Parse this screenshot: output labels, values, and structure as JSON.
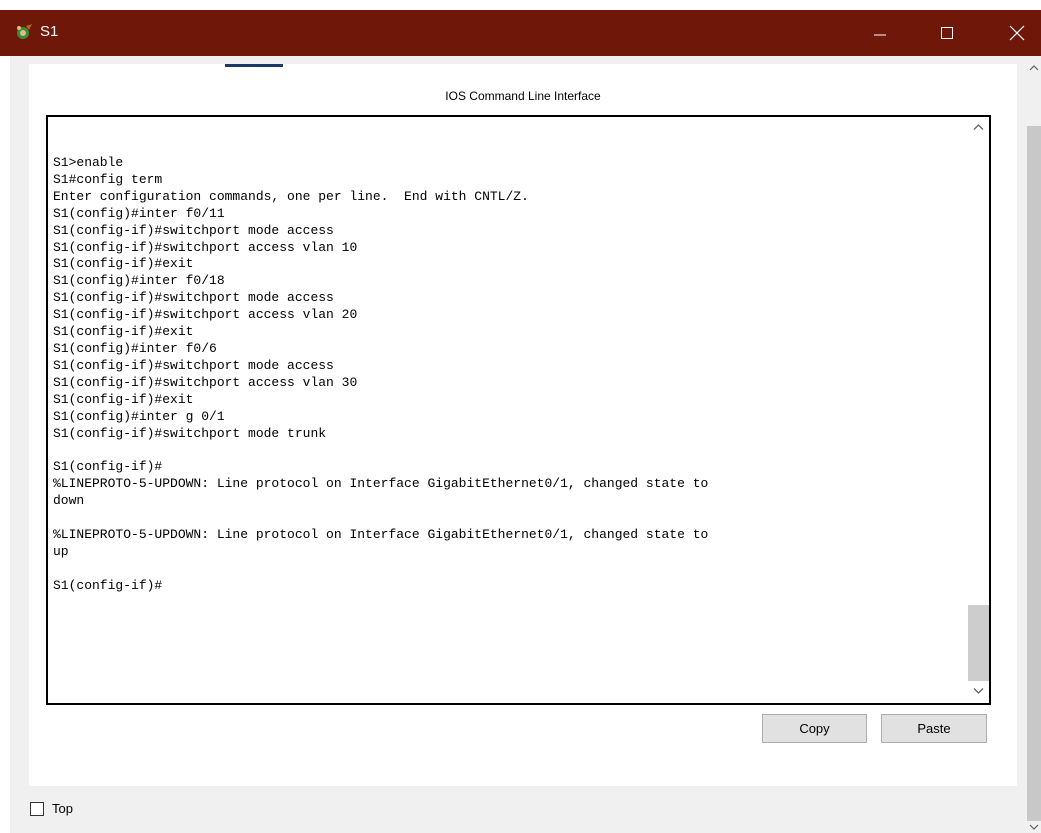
{
  "window": {
    "title": "S1"
  },
  "panel": {
    "title": "IOS Command Line Interface"
  },
  "terminal": {
    "lines": [
      "S1>enable",
      "S1#config term",
      "Enter configuration commands, one per line.  End with CNTL/Z.",
      "S1(config)#inter f0/11",
      "S1(config-if)#switchport mode access",
      "S1(config-if)#switchport access vlan 10",
      "S1(config-if)#exit",
      "S1(config)#inter f0/18",
      "S1(config-if)#switchport mode access",
      "S1(config-if)#switchport access vlan 20",
      "S1(config-if)#exit",
      "S1(config)#inter f0/6",
      "S1(config-if)#switchport mode access",
      "S1(config-if)#switchport access vlan 30",
      "S1(config-if)#exit",
      "S1(config)#inter g 0/1",
      "S1(config-if)#switchport mode trunk",
      "",
      "S1(config-if)#",
      "%LINEPROTO-5-UPDOWN: Line protocol on Interface GigabitEthernet0/1, changed state to",
      "down",
      "",
      "%LINEPROTO-5-UPDOWN: Line protocol on Interface GigabitEthernet0/1, changed state to",
      "up",
      "",
      "S1(config-if)#"
    ],
    "text": ""
  },
  "buttons": {
    "copy": "Copy",
    "paste": "Paste"
  },
  "top_checkbox": {
    "label": "Top",
    "checked": false
  },
  "colors": {
    "titlebar": "#6f1709",
    "frame": "#f0f0f0",
    "button": "#e1e1e1"
  },
  "icons": {
    "app": "packet-tracer-icon",
    "minimize": "minimize-icon",
    "maximize": "maximize-icon",
    "close": "close-icon"
  }
}
